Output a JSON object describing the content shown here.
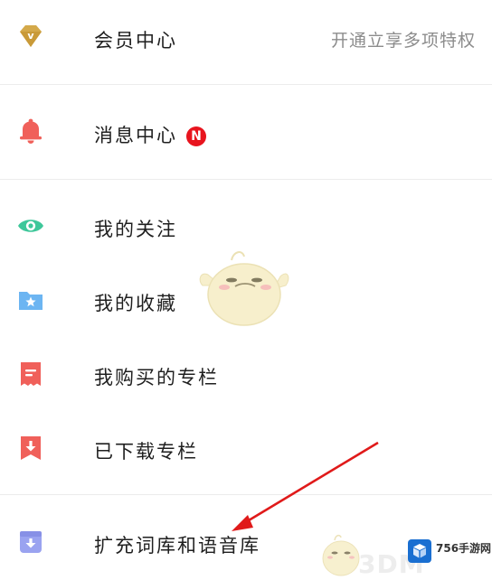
{
  "menu": {
    "vip": {
      "label": "会员中心",
      "right_text": "开通立享多项特权",
      "icon": "diamond-vip-icon",
      "color": "#d4a94a"
    },
    "messages": {
      "label": "消息中心",
      "badge": "N",
      "icon": "bell-icon",
      "color": "#f0605a",
      "badge_color": "#e8141e"
    },
    "following": {
      "label": "我的关注",
      "icon": "eye-icon",
      "color": "#3ec79a"
    },
    "favorites": {
      "label": "我的收藏",
      "icon": "star-folder-icon",
      "color": "#6cb5f2"
    },
    "purchased": {
      "label": "我购买的专栏",
      "icon": "receipt-icon",
      "color": "#f0605a"
    },
    "downloaded": {
      "label": "已下载专栏",
      "icon": "download-bookmark-icon",
      "color": "#f0605a"
    },
    "expand": {
      "label": "扩充词库和语音库",
      "icon": "download-box-icon",
      "color": "#9aa3f0"
    }
  },
  "watermark": {
    "site": "756手游网",
    "ghost_text": "3DM"
  },
  "annotation": {
    "color": "#e01a1a"
  }
}
